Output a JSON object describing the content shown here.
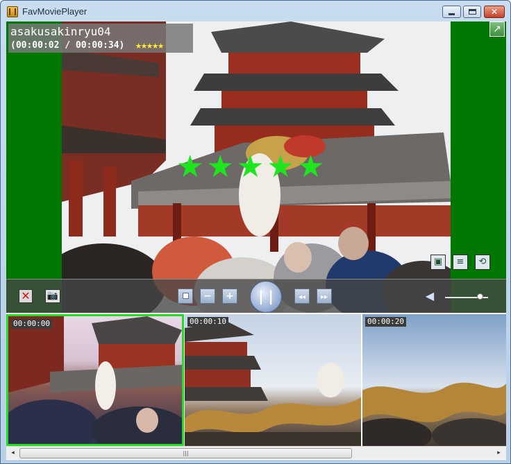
{
  "window": {
    "title": "FavMoviePlayer",
    "controls": {
      "minimize_icon": "minimize-icon",
      "maximize_icon": "maximize-icon",
      "close_glyph": "✕"
    }
  },
  "video": {
    "title": "asakusakinryu04",
    "time_display": "(00:00:02 / 00:00:34)",
    "small_rating_glyphs": "★★★★★",
    "large_rating_glyphs": "★★★★★",
    "rating": 5,
    "colors": {
      "letterbox": "#007700",
      "small_stars": "#ffe833",
      "large_stars": "#1ee61e"
    }
  },
  "overlay_buttons": {
    "fullscreen_glyph": "↗",
    "open_glyph": "▣",
    "playlist_glyph": "≡",
    "repeat_glyph": "⟲"
  },
  "controls": {
    "delete_glyph": "✕",
    "snapshot_glyph": "📷",
    "minus_glyph": "−",
    "plus_glyph": "+",
    "pause_glyph": "| |",
    "rewind_glyph": "◂◂",
    "forward_glyph": "▸▸",
    "volume_glyph": "◀",
    "volume_level": 0.8
  },
  "thumbnails": [
    {
      "time": "00:00:00",
      "selected": true
    },
    {
      "time": "00:00:10",
      "selected": false
    },
    {
      "time": "00:00:20",
      "selected": false
    }
  ],
  "scrollbar": {
    "left_glyph": "◂",
    "right_glyph": "▸",
    "grip_glyph": "|||"
  }
}
